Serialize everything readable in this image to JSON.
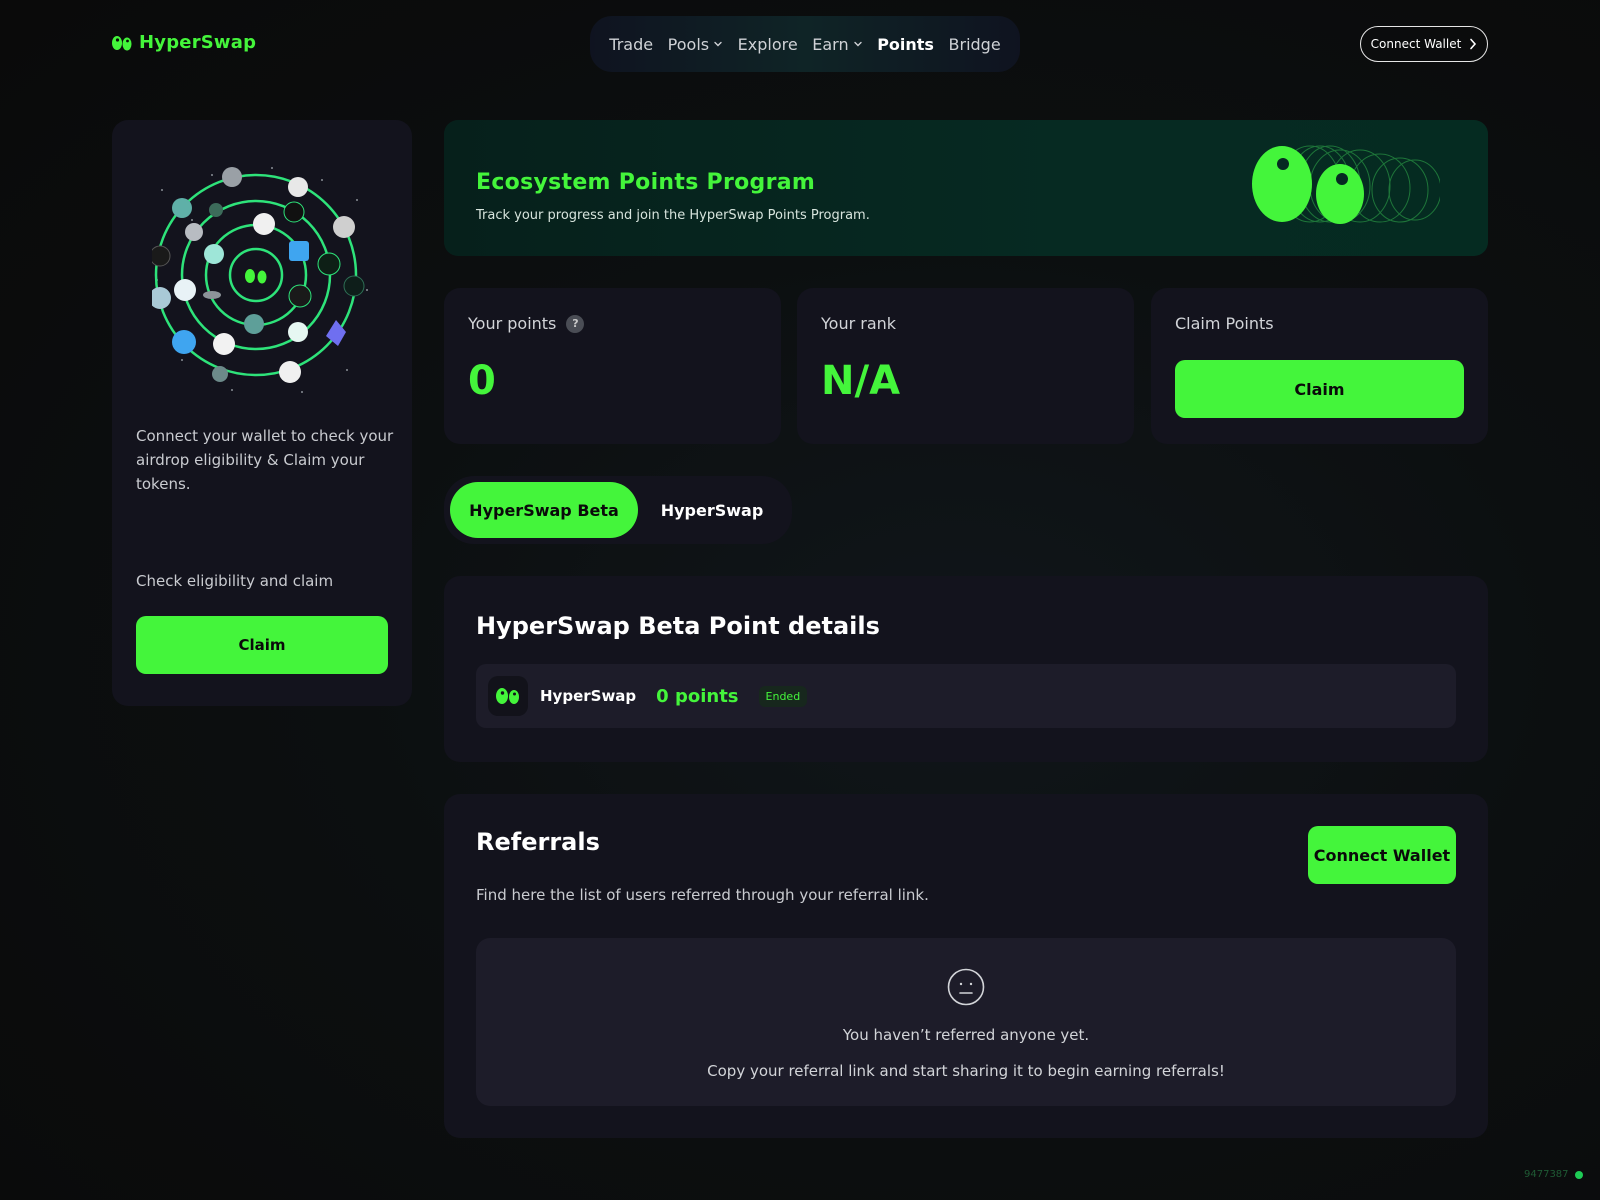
{
  "brand": {
    "name": "HyperSwap",
    "accent": "#44f53b"
  },
  "nav": {
    "items": [
      {
        "label": "Trade",
        "dropdown": false
      },
      {
        "label": "Pools",
        "dropdown": true
      },
      {
        "label": "Explore",
        "dropdown": false
      },
      {
        "label": "Earn",
        "dropdown": true
      },
      {
        "label": "Points",
        "dropdown": false,
        "active": true
      },
      {
        "label": "Bridge",
        "dropdown": false
      }
    ]
  },
  "header": {
    "connect_label": "Connect Wallet"
  },
  "airdrop": {
    "description": "Connect your wallet to check your airdrop eligibility & Claim your tokens.",
    "check_label": "Check eligibility and claim",
    "claim_label": "Claim"
  },
  "banner": {
    "title": "Ecosystem Points Program",
    "subtitle": "Track your progress and join the HyperSwap Points Program."
  },
  "stats": {
    "points_label": "Your points",
    "points_value": "0",
    "rank_label": "Your rank",
    "rank_value": "N/A",
    "claim_title": "Claim Points",
    "claim_label": "Claim"
  },
  "tabs": [
    {
      "label": "HyperSwap Beta",
      "active": true
    },
    {
      "label": "HyperSwap",
      "active": false
    }
  ],
  "details": {
    "title": "HyperSwap Beta Point details",
    "row": {
      "name": "HyperSwap",
      "points": "0 points",
      "status": "Ended"
    }
  },
  "referrals": {
    "title": "Referrals",
    "description": "Find here the list of users referred through your referral link.",
    "connect_label": "Connect Wallet",
    "empty_title": "You haven’t referred anyone yet.",
    "empty_subtitle": "Copy your referral link and start sharing it to begin earning referrals!"
  },
  "footer": {
    "build": "9477387"
  }
}
